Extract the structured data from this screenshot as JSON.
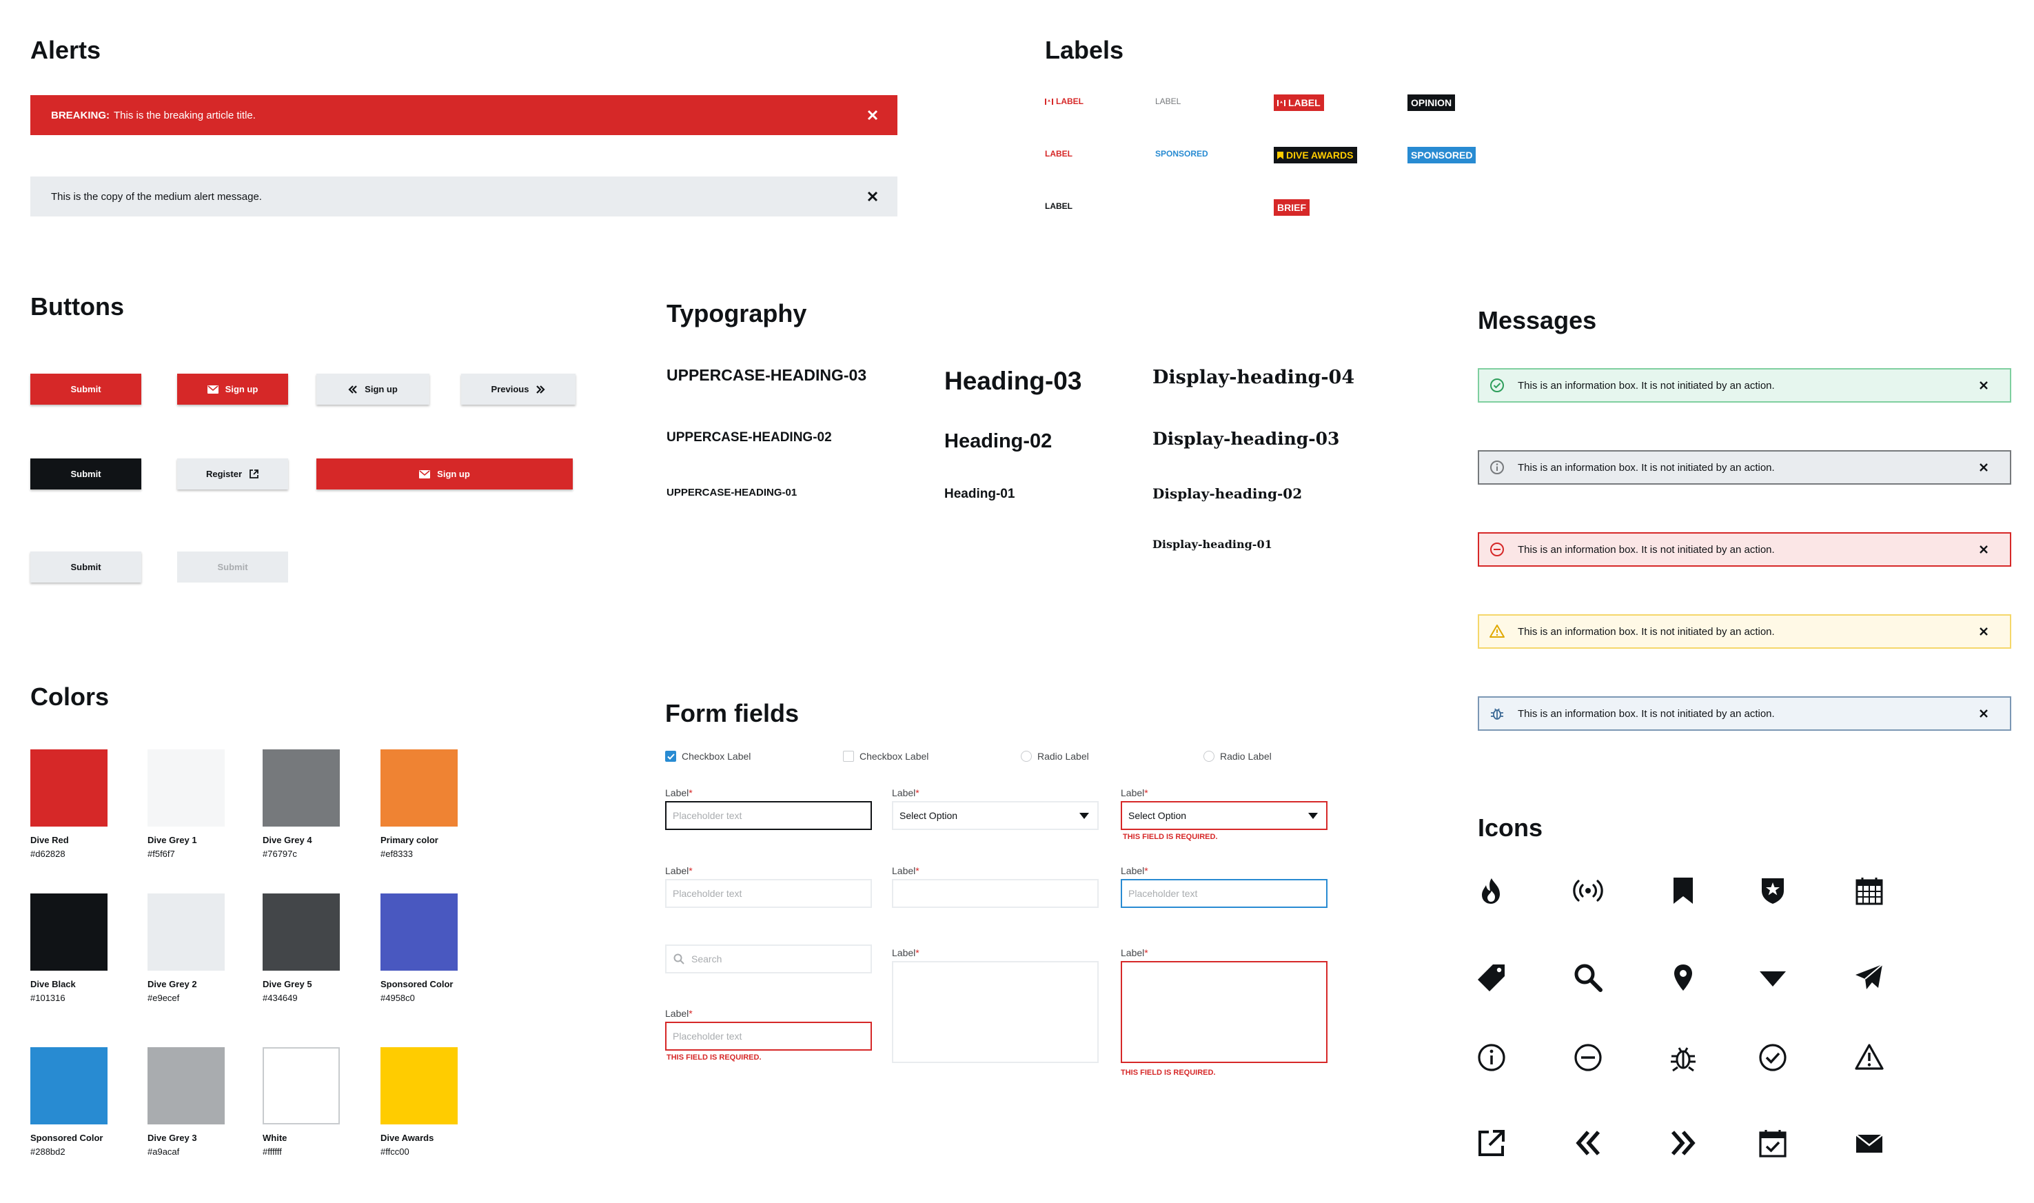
{
  "alerts": {
    "title": "Alerts",
    "breaking_prefix": "BREAKING:",
    "breaking_text": "This is the breaking article title.",
    "medium_text": "This is the copy of the medium alert message."
  },
  "labels": {
    "title": "Labels",
    "items": [
      {
        "text": "LABEL",
        "style": "red-text-flag"
      },
      {
        "text": "LABEL",
        "style": "grey-text"
      },
      {
        "text": "LABEL",
        "style": "red-chip-flag"
      },
      {
        "text": "OPINION",
        "style": "black-chip"
      },
      {
        "text": "LABEL",
        "style": "red-text"
      },
      {
        "text": "SPONSORED",
        "style": "blue-text"
      },
      {
        "text": "DIVE AWARDS",
        "style": "black-chip-yellow"
      },
      {
        "text": "SPONSORED",
        "style": "blue-chip"
      },
      {
        "text": "LABEL",
        "style": "black-text"
      },
      {
        "text": "BRIEF",
        "style": "red-chip"
      }
    ]
  },
  "buttons": {
    "title": "Buttons",
    "submit": "Submit",
    "sign_up": "Sign up",
    "previous": "Previous",
    "register": "Register"
  },
  "typography": {
    "title": "Typography",
    "upper_03": "UPPERCASE-HEADING-03",
    "upper_02": "UPPERCASE-HEADING-02",
    "upper_01": "UPPERCASE-HEADING-01",
    "heading_03": "Heading-03",
    "heading_02": "Heading-02",
    "heading_01": "Heading-01",
    "display_04": "Display-heading-04",
    "display_03": "Display-heading-03",
    "display_02": "Display-heading-02",
    "display_01": "Display-heading-01"
  },
  "messages": {
    "title": "Messages",
    "text": "This is an information box. It is not initiated by an action.",
    "types": [
      {
        "kind": "success",
        "bg": "#e6f6ee",
        "border": "#7fcf9f",
        "icon": "check-circle-icon"
      },
      {
        "kind": "info",
        "bg": "#e9ecef",
        "border": "#76797c",
        "icon": "info-icon"
      },
      {
        "kind": "error",
        "bg": "#fbe6e6",
        "border": "#d62828",
        "icon": "minus-circle-icon"
      },
      {
        "kind": "warning",
        "bg": "#fff9e6",
        "border": "#f5d76a",
        "icon": "warning-icon"
      },
      {
        "kind": "debug",
        "bg": "#eef3f8",
        "border": "#7b97b4",
        "icon": "bug-icon"
      }
    ]
  },
  "colors": {
    "title": "Colors",
    "swatches": [
      {
        "name": "Dive Red",
        "hex": "#d62828"
      },
      {
        "name": "Dive Grey 1",
        "hex": "#f5f6f7"
      },
      {
        "name": "Dive Grey 4",
        "hex": "#76797c"
      },
      {
        "name": "Primary color",
        "hex": "#ef8333"
      },
      {
        "name": "Dive Black",
        "hex": "#101316"
      },
      {
        "name": "Dive Grey 2",
        "hex": "#e9ecef"
      },
      {
        "name": "Dive Grey 5",
        "hex": "#434649"
      },
      {
        "name": "Sponsored Color",
        "hex": "#4958c0"
      },
      {
        "name": "Sponsored Color",
        "hex": "#288bd2"
      },
      {
        "name": "Dive Grey 3",
        "hex": "#a9acaf"
      },
      {
        "name": "White",
        "hex": "#ffffff"
      },
      {
        "name": "Dive Awards",
        "hex": "#ffcc00"
      }
    ]
  },
  "forms": {
    "title": "Form fields",
    "checkbox_label": "Checkbox Label",
    "radio_label": "Radio Label",
    "label": "Label",
    "required_mark": "*",
    "placeholder": "Placeholder text",
    "select_option": "Select Option",
    "search_placeholder": "Search",
    "error": "THIS FIELD IS REQUIRED."
  },
  "icons": {
    "title": "Icons",
    "names": [
      "fire-icon",
      "broadcast-icon",
      "bookmark-icon",
      "shield-star-icon",
      "calendar-icon",
      "tag-icon",
      "search-icon",
      "map-pin-icon",
      "caret-down-icon",
      "paper-plane-icon",
      "info-icon",
      "minus-circle-icon",
      "bug-icon",
      "check-circle-icon",
      "warning-icon",
      "external-link-icon",
      "chevrons-left-icon",
      "chevrons-right-icon",
      "calendar-check-icon",
      "mail-icon"
    ]
  }
}
